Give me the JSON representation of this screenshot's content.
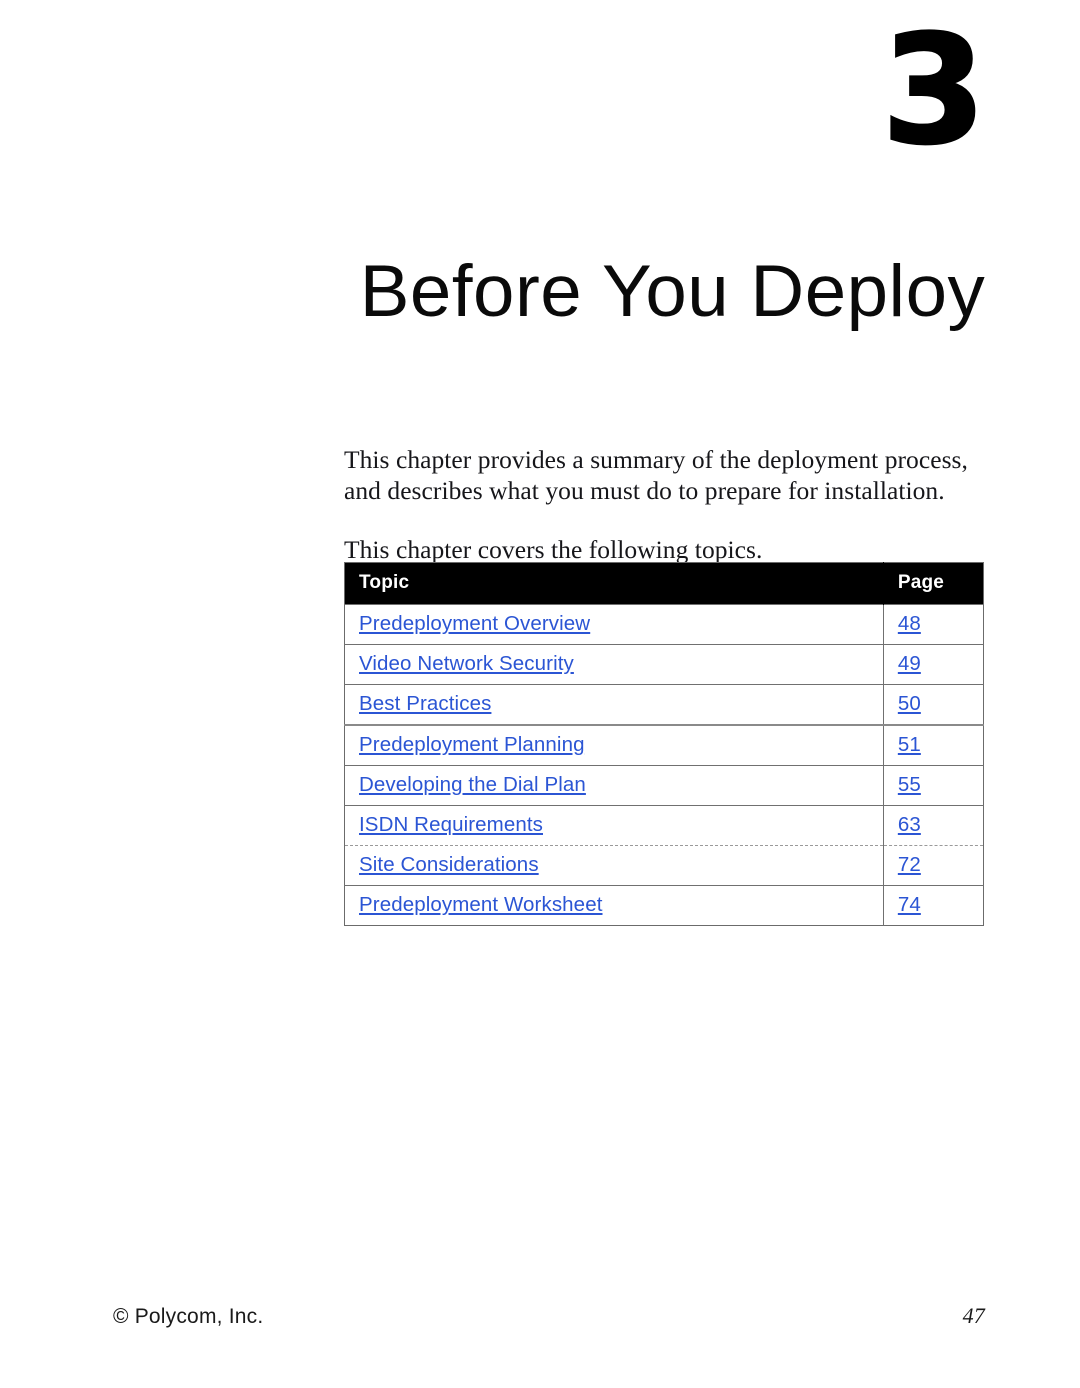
{
  "document": {
    "chapter_number": "3",
    "chapter_title": "Before You Deploy"
  },
  "intro": {
    "paragraph_1": "This chapter provides a summary of the deployment process, and describes what you must do to prepare for installation.",
    "paragraph_2": "This chapter covers the following topics."
  },
  "topics_table": {
    "headers": {
      "topic": "Topic",
      "page": "Page"
    },
    "rows": [
      {
        "topic": "Predeployment Overview",
        "page": "48"
      },
      {
        "topic": "Video Network Security",
        "page": "49"
      },
      {
        "topic": "Best Practices",
        "page": "50"
      },
      {
        "topic": "Predeployment Planning",
        "page": "51"
      },
      {
        "topic": "Developing the Dial Plan",
        "page": "55"
      },
      {
        "topic": "ISDN Requirements",
        "page": "63"
      },
      {
        "topic": "Site Considerations",
        "page": "72"
      },
      {
        "topic": "Predeployment Worksheet",
        "page": "74"
      }
    ]
  },
  "footer": {
    "copyright": "© Polycom, Inc.",
    "page_number": "47"
  },
  "colors": {
    "link": "#2b55d4",
    "header_background": "#000000",
    "header_text": "#ffffff",
    "body_text": "#16161a",
    "table_border": "#707070"
  }
}
